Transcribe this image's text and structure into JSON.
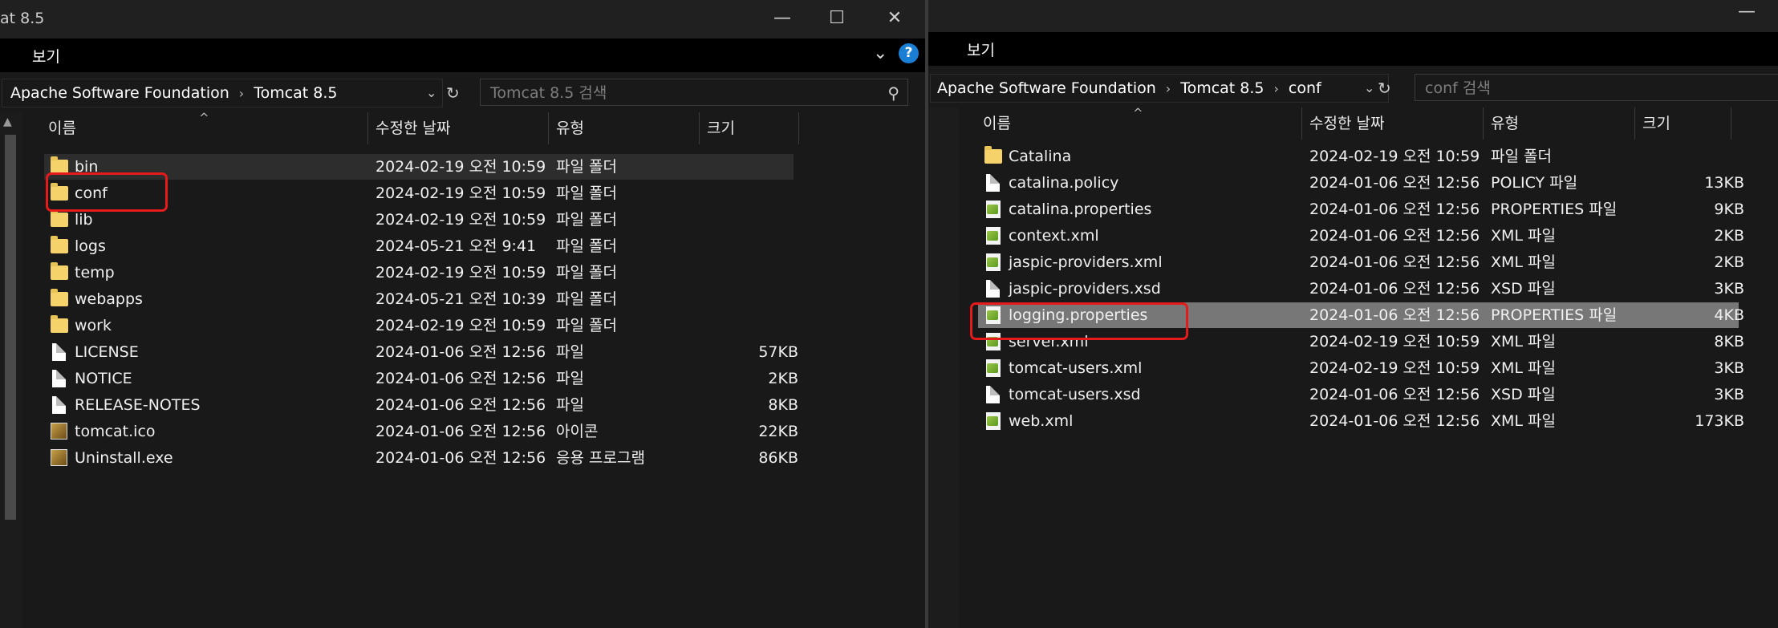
{
  "left": {
    "title": "at 8.5",
    "menu": "보기",
    "address": {
      "crumbs": [
        "Apache Software Foundation",
        "Tomcat 8.5"
      ]
    },
    "search_placeholder": "Tomcat 8.5 검색",
    "columns": {
      "name": "이름",
      "date": "수정한 날짜",
      "type": "유형",
      "size": "크기"
    },
    "rows": [
      {
        "name": "bin",
        "date": "2024-02-19 오전 10:59",
        "type": "파일 폴더",
        "size": "",
        "icon": "folder-icon"
      },
      {
        "name": "conf",
        "date": "2024-02-19 오전 10:59",
        "type": "파일 폴더",
        "size": "",
        "icon": "folder-icon"
      },
      {
        "name": "lib",
        "date": "2024-02-19 오전 10:59",
        "type": "파일 폴더",
        "size": "",
        "icon": "folder-icon"
      },
      {
        "name": "logs",
        "date": "2024-05-21 오전 9:41",
        "type": "파일 폴더",
        "size": "",
        "icon": "folder-icon"
      },
      {
        "name": "temp",
        "date": "2024-02-19 오전 10:59",
        "type": "파일 폴더",
        "size": "",
        "icon": "folder-icon"
      },
      {
        "name": "webapps",
        "date": "2024-05-21 오전 10:39",
        "type": "파일 폴더",
        "size": "",
        "icon": "folder-icon"
      },
      {
        "name": "work",
        "date": "2024-02-19 오전 10:59",
        "type": "파일 폴더",
        "size": "",
        "icon": "folder-icon"
      },
      {
        "name": "LICENSE",
        "date": "2024-01-06 오전 12:56",
        "type": "파일",
        "size": "57KB",
        "icon": "file-icon"
      },
      {
        "name": "NOTICE",
        "date": "2024-01-06 오전 12:56",
        "type": "파일",
        "size": "2KB",
        "icon": "file-icon"
      },
      {
        "name": "RELEASE-NOTES",
        "date": "2024-01-06 오전 12:56",
        "type": "파일",
        "size": "8KB",
        "icon": "file-icon"
      },
      {
        "name": "tomcat.ico",
        "date": "2024-01-06 오전 12:56",
        "type": "아이콘",
        "size": "22KB",
        "icon": "tomcat-image-icon"
      },
      {
        "name": "Uninstall.exe",
        "date": "2024-01-06 오전 12:56",
        "type": "응용 프로그램",
        "size": "86KB",
        "icon": "tomcat-image-icon"
      }
    ]
  },
  "right": {
    "menu": "보기",
    "address": {
      "crumbs": [
        "Apache Software Foundation",
        "Tomcat 8.5",
        "conf"
      ]
    },
    "search_placeholder": "conf 검색",
    "columns": {
      "name": "이름",
      "date": "수정한 날짜",
      "type": "유형",
      "size": "크기"
    },
    "rows": [
      {
        "name": "Catalina",
        "date": "2024-02-19 오전 10:59",
        "type": "파일 폴더",
        "size": "",
        "icon": "folder-icon"
      },
      {
        "name": "catalina.policy",
        "date": "2024-01-06 오전 12:56",
        "type": "POLICY 파일",
        "size": "13KB",
        "icon": "file-icon"
      },
      {
        "name": "catalina.properties",
        "date": "2024-01-06 오전 12:56",
        "type": "PROPERTIES 파일",
        "size": "9KB",
        "icon": "config-file-icon"
      },
      {
        "name": "context.xml",
        "date": "2024-01-06 오전 12:56",
        "type": "XML 파일",
        "size": "2KB",
        "icon": "config-file-icon"
      },
      {
        "name": "jaspic-providers.xml",
        "date": "2024-01-06 오전 12:56",
        "type": "XML 파일",
        "size": "2KB",
        "icon": "config-file-icon"
      },
      {
        "name": "jaspic-providers.xsd",
        "date": "2024-01-06 오전 12:56",
        "type": "XSD 파일",
        "size": "3KB",
        "icon": "file-icon"
      },
      {
        "name": "logging.properties",
        "date": "2024-01-06 오전 12:56",
        "type": "PROPERTIES 파일",
        "size": "4KB",
        "icon": "config-file-icon"
      },
      {
        "name": "server.xml",
        "date": "2024-02-19 오전 10:59",
        "type": "XML 파일",
        "size": "8KB",
        "icon": "config-file-icon"
      },
      {
        "name": "tomcat-users.xml",
        "date": "2024-02-19 오전 10:59",
        "type": "XML 파일",
        "size": "3KB",
        "icon": "config-file-icon"
      },
      {
        "name": "tomcat-users.xsd",
        "date": "2024-01-06 오전 12:56",
        "type": "XSD 파일",
        "size": "3KB",
        "icon": "file-icon"
      },
      {
        "name": "web.xml",
        "date": "2024-01-06 오전 12:56",
        "type": "XML 파일",
        "size": "173KB",
        "icon": "config-file-icon"
      }
    ]
  },
  "colors": {
    "highlight": "#e51b1b",
    "selected_row": "#777777",
    "hover_row": "#2d2d2d",
    "folder": "#f5d36a",
    "help": "#1a7fd4"
  }
}
